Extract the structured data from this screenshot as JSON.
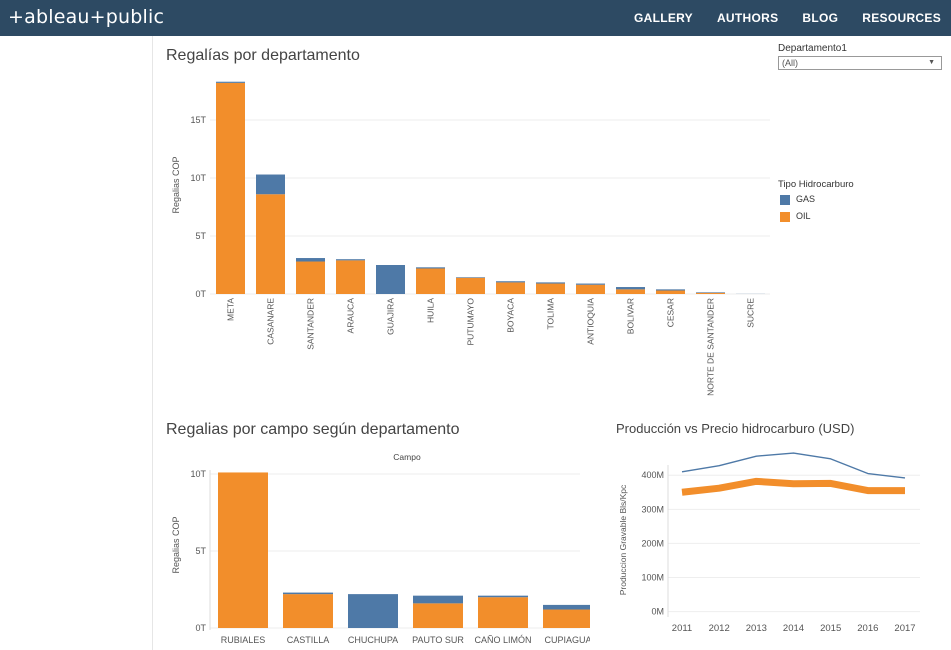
{
  "app": {
    "logo": "+ableau+public",
    "nav": [
      "GALLERY",
      "AUTHORS",
      "BLOG",
      "RESOURCES"
    ]
  },
  "filter": {
    "label": "Departamento1",
    "value": "(All)"
  },
  "legend": {
    "title": "Tipo Hidrocarburo",
    "items": [
      {
        "label": "GAS",
        "color": "#4e79a7"
      },
      {
        "label": "OIL",
        "color": "#f28e2b"
      }
    ]
  },
  "colors": {
    "gas": "#4e79a7",
    "oil": "#f28e2b",
    "header": "#2d4a63"
  },
  "chart_data": [
    {
      "type": "bar",
      "title": "Regalías por departamento",
      "ylabel": "Regalias COP",
      "xlabel": "",
      "yticks": [
        "0T",
        "5T",
        "10T",
        "15T"
      ],
      "ylim": [
        0,
        19
      ],
      "categories": [
        "META",
        "CASANARE",
        "SANTANDER",
        "ARAUCA",
        "GUAJIRA",
        "HUILA",
        "PUTUMAYO",
        "BOYACA",
        "TOLIMA",
        "ANTIOQUIA",
        "BOLIVAR",
        "CESAR",
        "NORTE DE SANTANDER",
        "SUCRE"
      ],
      "series": [
        {
          "name": "OIL",
          "values": [
            18.2,
            8.6,
            2.8,
            2.9,
            0,
            2.2,
            1.4,
            1.0,
            0.9,
            0.8,
            0.4,
            0.3,
            0.1,
            0
          ]
        },
        {
          "name": "GAS",
          "values": [
            0.1,
            1.7,
            0.3,
            0.1,
            2.5,
            0.1,
            0.05,
            0.1,
            0.1,
            0.1,
            0.2,
            0.1,
            0.05,
            0.01
          ]
        }
      ]
    },
    {
      "type": "bar",
      "title": "Regalias por campo según departamento",
      "header": "Campo",
      "ylabel": "Regalias COP",
      "xlabel": "",
      "yticks": [
        "0T",
        "5T",
        "10T"
      ],
      "ylim": [
        0,
        10.2
      ],
      "categories": [
        "RUBIALES",
        "CASTILLA",
        "CHUCHUPA",
        "PAUTO SUR",
        "CAÑO LIMÓN",
        "CUPIAGUA"
      ],
      "series": [
        {
          "name": "OIL",
          "values": [
            10.1,
            2.2,
            0,
            1.6,
            2.0,
            1.2
          ]
        },
        {
          "name": "GAS",
          "values": [
            0,
            0.1,
            2.2,
            0.5,
            0.1,
            0.3
          ]
        }
      ]
    },
    {
      "type": "line",
      "title": "Producción vs Precio hidrocarburo (USD)",
      "ylabel": "Produccion Gravable Bls/Kpc",
      "xlabel": "",
      "yticks": [
        "0M",
        "100M",
        "200M",
        "300M",
        "400M"
      ],
      "ylim": [
        -10,
        430
      ],
      "x": [
        2011,
        2012,
        2013,
        2014,
        2015,
        2016,
        2017
      ],
      "series": [
        {
          "name": "GAS",
          "values": [
            410,
            428,
            456,
            465,
            448,
            405,
            392
          ]
        },
        {
          "name": "OIL",
          "values": [
            350,
            362,
            382,
            375,
            376,
            355,
            355
          ]
        }
      ]
    }
  ]
}
